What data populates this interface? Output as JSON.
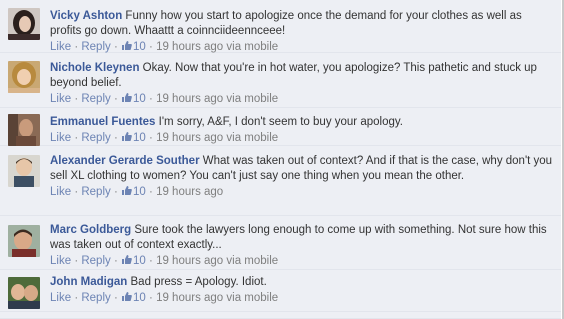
{
  "comments": [
    {
      "name": "Vicky Ashton",
      "text": "Funny how you start to apologize once the demand for your clothes as well as profits go down. Whaattt a coinnciideennceee!",
      "like": "Like",
      "reply": "Reply",
      "likes": "10",
      "time": "19 hours ago",
      "via": "via mobile"
    },
    {
      "name": "Nichole Kleynen",
      "text": "Okay. Now that you're in hot water, you apologize? This pathetic and stuck up beyond belief.",
      "like": "Like",
      "reply": "Reply",
      "likes": "10",
      "time": "19 hours ago",
      "via": "via mobile"
    },
    {
      "name": "Emmanuel Fuentes",
      "text": "I'm sorry, A&F, I don't seem to buy your apology.",
      "like": "Like",
      "reply": "Reply",
      "likes": "10",
      "time": "19 hours ago",
      "via": "via mobile"
    },
    {
      "name": "Alexander Gerarde Souther",
      "text": "What was taken out of context? And if that is the case, why don't you sell XL clothing to women? You can't just say one thing when you mean the other.",
      "like": "Like",
      "reply": "Reply",
      "likes": "10",
      "time": "19 hours ago",
      "via": ""
    },
    {
      "name": "Marc Goldberg",
      "text": "Sure took the lawyers long enough to come up with something. Not sure how this was taken out of context exactly...",
      "like": "Like",
      "reply": "Reply",
      "likes": "10",
      "time": "19 hours ago",
      "via": "via mobile"
    },
    {
      "name": "John Madigan",
      "text": "Bad press = Apology. Idiot.",
      "like": "Like",
      "reply": "Reply",
      "likes": "10",
      "time": "19 hours ago",
      "via": "via mobile"
    }
  ],
  "separator": "·",
  "colors": {
    "comment_bg": "#edeff4",
    "name": "#3b5998",
    "link": "#6d84b4",
    "meta": "#7f7f7f"
  },
  "icons": {
    "likes": "thumbs-up-icon"
  }
}
